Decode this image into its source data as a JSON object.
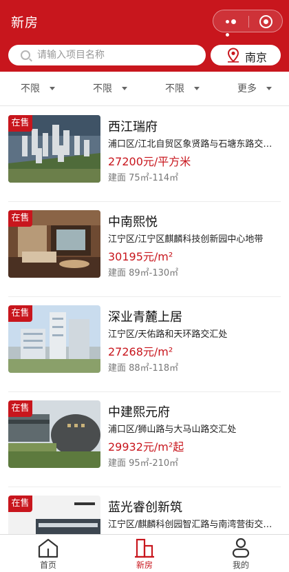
{
  "header": {
    "title": "新房",
    "search_placeholder": "请输入项目名称",
    "city": "南京"
  },
  "filters": [
    "不限",
    "不限",
    "不限",
    "更多"
  ],
  "listings": [
    {
      "status": "在售",
      "name": "西江瑞府",
      "address": "浦口区/江北自贸区象贤路与石塘东路交汇处",
      "price": "27200元/平方米",
      "area": "建面 75㎡-114㎡"
    },
    {
      "status": "在售",
      "name": "中南熙悦",
      "address": "江宁区/江宁区麒麟科技创新园中心地带",
      "price": "30195元/m²",
      "area": "建面 89㎡-130㎡"
    },
    {
      "status": "在售",
      "name": "深业青麓上居",
      "address": "江宁区/天佑路和天环路交汇处",
      "price": "27268元/m²",
      "area": "建面 88㎡-118㎡"
    },
    {
      "status": "在售",
      "name": "中建熙元府",
      "address": "浦口区/狮山路与大马山路交汇处",
      "price": "29932元/m²起",
      "area": "建面 95㎡-210㎡"
    },
    {
      "status": "在售",
      "name": "蓝光睿创新筑",
      "address": "江宁区/麒麟科创园智汇路与南湾营街交汇处",
      "price": "",
      "area": ""
    }
  ],
  "tabbar": {
    "items": [
      {
        "label": "首页",
        "icon": "home-icon"
      },
      {
        "label": "新房",
        "icon": "building-icon"
      },
      {
        "label": "我的",
        "icon": "user-icon"
      }
    ],
    "active_index": 1
  },
  "colors": {
    "brand": "#c8161d",
    "text_primary": "#111111",
    "text_secondary": "#777777"
  }
}
